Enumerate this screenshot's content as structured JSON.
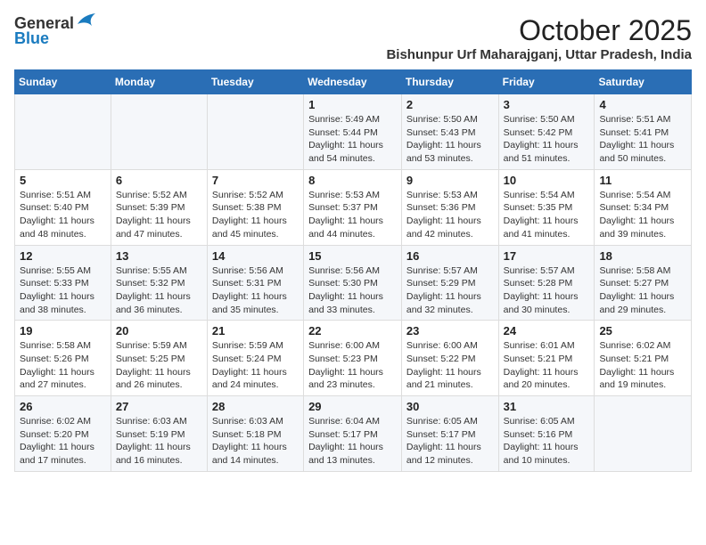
{
  "header": {
    "logo_general": "General",
    "logo_blue": "Blue",
    "month_year": "October 2025",
    "location": "Bishunpur Urf Maharajganj, Uttar Pradesh, India"
  },
  "weekdays": [
    "Sunday",
    "Monday",
    "Tuesday",
    "Wednesday",
    "Thursday",
    "Friday",
    "Saturday"
  ],
  "weeks": [
    [
      {
        "day": "",
        "info": ""
      },
      {
        "day": "",
        "info": ""
      },
      {
        "day": "",
        "info": ""
      },
      {
        "day": "1",
        "info": "Sunrise: 5:49 AM\nSunset: 5:44 PM\nDaylight: 11 hours\nand 54 minutes."
      },
      {
        "day": "2",
        "info": "Sunrise: 5:50 AM\nSunset: 5:43 PM\nDaylight: 11 hours\nand 53 minutes."
      },
      {
        "day": "3",
        "info": "Sunrise: 5:50 AM\nSunset: 5:42 PM\nDaylight: 11 hours\nand 51 minutes."
      },
      {
        "day": "4",
        "info": "Sunrise: 5:51 AM\nSunset: 5:41 PM\nDaylight: 11 hours\nand 50 minutes."
      }
    ],
    [
      {
        "day": "5",
        "info": "Sunrise: 5:51 AM\nSunset: 5:40 PM\nDaylight: 11 hours\nand 48 minutes."
      },
      {
        "day": "6",
        "info": "Sunrise: 5:52 AM\nSunset: 5:39 PM\nDaylight: 11 hours\nand 47 minutes."
      },
      {
        "day": "7",
        "info": "Sunrise: 5:52 AM\nSunset: 5:38 PM\nDaylight: 11 hours\nand 45 minutes."
      },
      {
        "day": "8",
        "info": "Sunrise: 5:53 AM\nSunset: 5:37 PM\nDaylight: 11 hours\nand 44 minutes."
      },
      {
        "day": "9",
        "info": "Sunrise: 5:53 AM\nSunset: 5:36 PM\nDaylight: 11 hours\nand 42 minutes."
      },
      {
        "day": "10",
        "info": "Sunrise: 5:54 AM\nSunset: 5:35 PM\nDaylight: 11 hours\nand 41 minutes."
      },
      {
        "day": "11",
        "info": "Sunrise: 5:54 AM\nSunset: 5:34 PM\nDaylight: 11 hours\nand 39 minutes."
      }
    ],
    [
      {
        "day": "12",
        "info": "Sunrise: 5:55 AM\nSunset: 5:33 PM\nDaylight: 11 hours\nand 38 minutes."
      },
      {
        "day": "13",
        "info": "Sunrise: 5:55 AM\nSunset: 5:32 PM\nDaylight: 11 hours\nand 36 minutes."
      },
      {
        "day": "14",
        "info": "Sunrise: 5:56 AM\nSunset: 5:31 PM\nDaylight: 11 hours\nand 35 minutes."
      },
      {
        "day": "15",
        "info": "Sunrise: 5:56 AM\nSunset: 5:30 PM\nDaylight: 11 hours\nand 33 minutes."
      },
      {
        "day": "16",
        "info": "Sunrise: 5:57 AM\nSunset: 5:29 PM\nDaylight: 11 hours\nand 32 minutes."
      },
      {
        "day": "17",
        "info": "Sunrise: 5:57 AM\nSunset: 5:28 PM\nDaylight: 11 hours\nand 30 minutes."
      },
      {
        "day": "18",
        "info": "Sunrise: 5:58 AM\nSunset: 5:27 PM\nDaylight: 11 hours\nand 29 minutes."
      }
    ],
    [
      {
        "day": "19",
        "info": "Sunrise: 5:58 AM\nSunset: 5:26 PM\nDaylight: 11 hours\nand 27 minutes."
      },
      {
        "day": "20",
        "info": "Sunrise: 5:59 AM\nSunset: 5:25 PM\nDaylight: 11 hours\nand 26 minutes."
      },
      {
        "day": "21",
        "info": "Sunrise: 5:59 AM\nSunset: 5:24 PM\nDaylight: 11 hours\nand 24 minutes."
      },
      {
        "day": "22",
        "info": "Sunrise: 6:00 AM\nSunset: 5:23 PM\nDaylight: 11 hours\nand 23 minutes."
      },
      {
        "day": "23",
        "info": "Sunrise: 6:00 AM\nSunset: 5:22 PM\nDaylight: 11 hours\nand 21 minutes."
      },
      {
        "day": "24",
        "info": "Sunrise: 6:01 AM\nSunset: 5:21 PM\nDaylight: 11 hours\nand 20 minutes."
      },
      {
        "day": "25",
        "info": "Sunrise: 6:02 AM\nSunset: 5:21 PM\nDaylight: 11 hours\nand 19 minutes."
      }
    ],
    [
      {
        "day": "26",
        "info": "Sunrise: 6:02 AM\nSunset: 5:20 PM\nDaylight: 11 hours\nand 17 minutes."
      },
      {
        "day": "27",
        "info": "Sunrise: 6:03 AM\nSunset: 5:19 PM\nDaylight: 11 hours\nand 16 minutes."
      },
      {
        "day": "28",
        "info": "Sunrise: 6:03 AM\nSunset: 5:18 PM\nDaylight: 11 hours\nand 14 minutes."
      },
      {
        "day": "29",
        "info": "Sunrise: 6:04 AM\nSunset: 5:17 PM\nDaylight: 11 hours\nand 13 minutes."
      },
      {
        "day": "30",
        "info": "Sunrise: 6:05 AM\nSunset: 5:17 PM\nDaylight: 11 hours\nand 12 minutes."
      },
      {
        "day": "31",
        "info": "Sunrise: 6:05 AM\nSunset: 5:16 PM\nDaylight: 11 hours\nand 10 minutes."
      },
      {
        "day": "",
        "info": ""
      }
    ]
  ]
}
